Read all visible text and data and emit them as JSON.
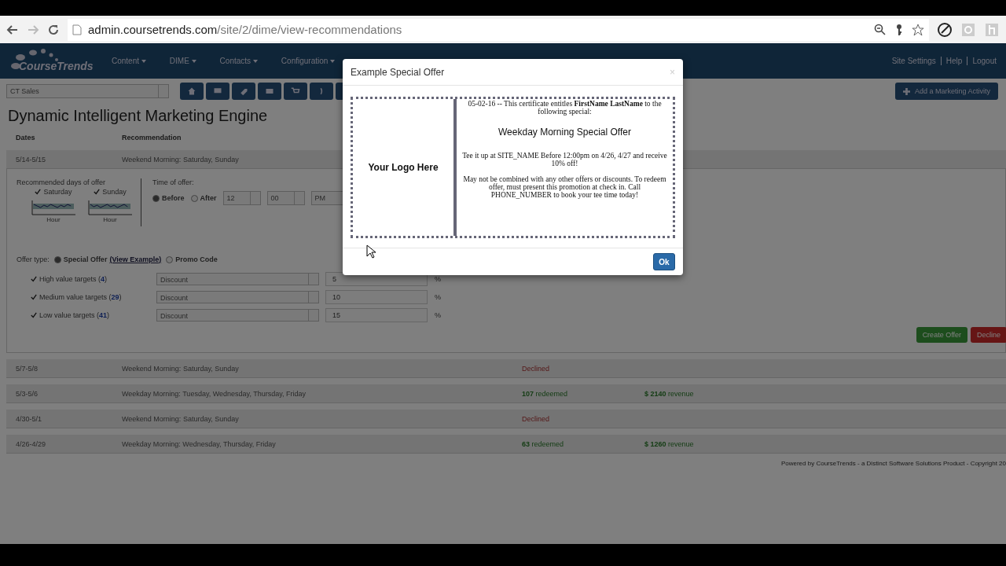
{
  "browser": {
    "url_host": "admin.coursetrends.com",
    "url_path": "/site/2/dime/view-recommendations"
  },
  "nav": {
    "logo": "CourseTrends",
    "menus": [
      "Content",
      "DIME",
      "Contacts",
      "Configuration"
    ],
    "links": [
      "Site Settings",
      "Help",
      "Logout"
    ]
  },
  "toolbar": {
    "site_select": "CT Sales",
    "add_button": "Add a Marketing Activity"
  },
  "page_title": "Dynamic Intelligent Marketing Engine",
  "columns": [
    "Dates",
    "Recommendation"
  ],
  "expanded": {
    "dates": "5/14-5/15",
    "recommendation": "Weekend Morning: Saturday, Sunday",
    "days_label": "Recommended days of offer",
    "days": [
      {
        "label": "Saturday",
        "checked": true,
        "axis": "Hour"
      },
      {
        "label": "Sunday",
        "checked": true,
        "axis": "Hour"
      }
    ],
    "time_label": "Time of offer:",
    "time_options": [
      {
        "label": "Before",
        "selected": true
      },
      {
        "label": "After",
        "selected": false
      }
    ],
    "hour": "12",
    "minute": "00",
    "ampm": "PM",
    "offer_label": "Offer type:",
    "offer_options": [
      {
        "label": "Special Offer",
        "link": "(View Example)",
        "selected": true
      },
      {
        "label": "Promo Code",
        "selected": false
      }
    ],
    "targets": [
      {
        "label": "High value targets (**4**)",
        "checked": true,
        "type": "Discount",
        "amount": "5",
        "unit": "%"
      },
      {
        "label": "Medium value targets (**29**)",
        "checked": true,
        "type": "Discount",
        "amount": "10",
        "unit": "%"
      },
      {
        "label": "Low value targets (**41**)",
        "checked": true,
        "type": "Discount",
        "amount": "15",
        "unit": "%"
      }
    ],
    "buttons": [
      {
        "label": "Create Offer",
        "kind": "create"
      },
      {
        "label": "Decline",
        "kind": "decline"
      }
    ]
  },
  "rows": [
    {
      "dates": "5/7-5/8",
      "recommendation": "Weekend Morning: Saturday, Sunday",
      "kind": "declined",
      "status": "Declined"
    },
    {
      "dates": "5/3-5/6",
      "recommendation": "Weekday Morning: Tuesday, Wednesday, Thursday, Friday",
      "kind": "redeemed",
      "status": "**107** redeemed",
      "revenue": "**$ 2140** revenue"
    },
    {
      "dates": "4/30-5/1",
      "recommendation": "Weekend Morning: Saturday, Sunday",
      "kind": "declined",
      "status": "Declined"
    },
    {
      "dates": "4/26-4/29",
      "recommendation": "Weekday Morning: Wednesday, Thursday, Friday",
      "kind": "redeemed",
      "status": "**63** redeemed",
      "revenue": "**$ 1260** revenue"
    }
  ],
  "footer": "Powered by CourseTrends - a Distinct Software Solutions Product - Copyright 20",
  "modal": {
    "title": "Example Special Offer",
    "close": "×",
    "logo_text": "Your Logo Here",
    "intro": "05-02-16 -- This certificate entitles **FirstName LastName** to the following special:",
    "heading": "Weekday Morning Special Offer",
    "offer": "Tee it up at SITE_NAME Before 12:00pm on 4/26, 4/27 and receive 10% off!",
    "terms": "May not be combined with any other offers or discounts. To redeem offer, must present this promotion at check in. Call PHONE_NUMBER to book your tee time today!",
    "ok": "Ok"
  }
}
